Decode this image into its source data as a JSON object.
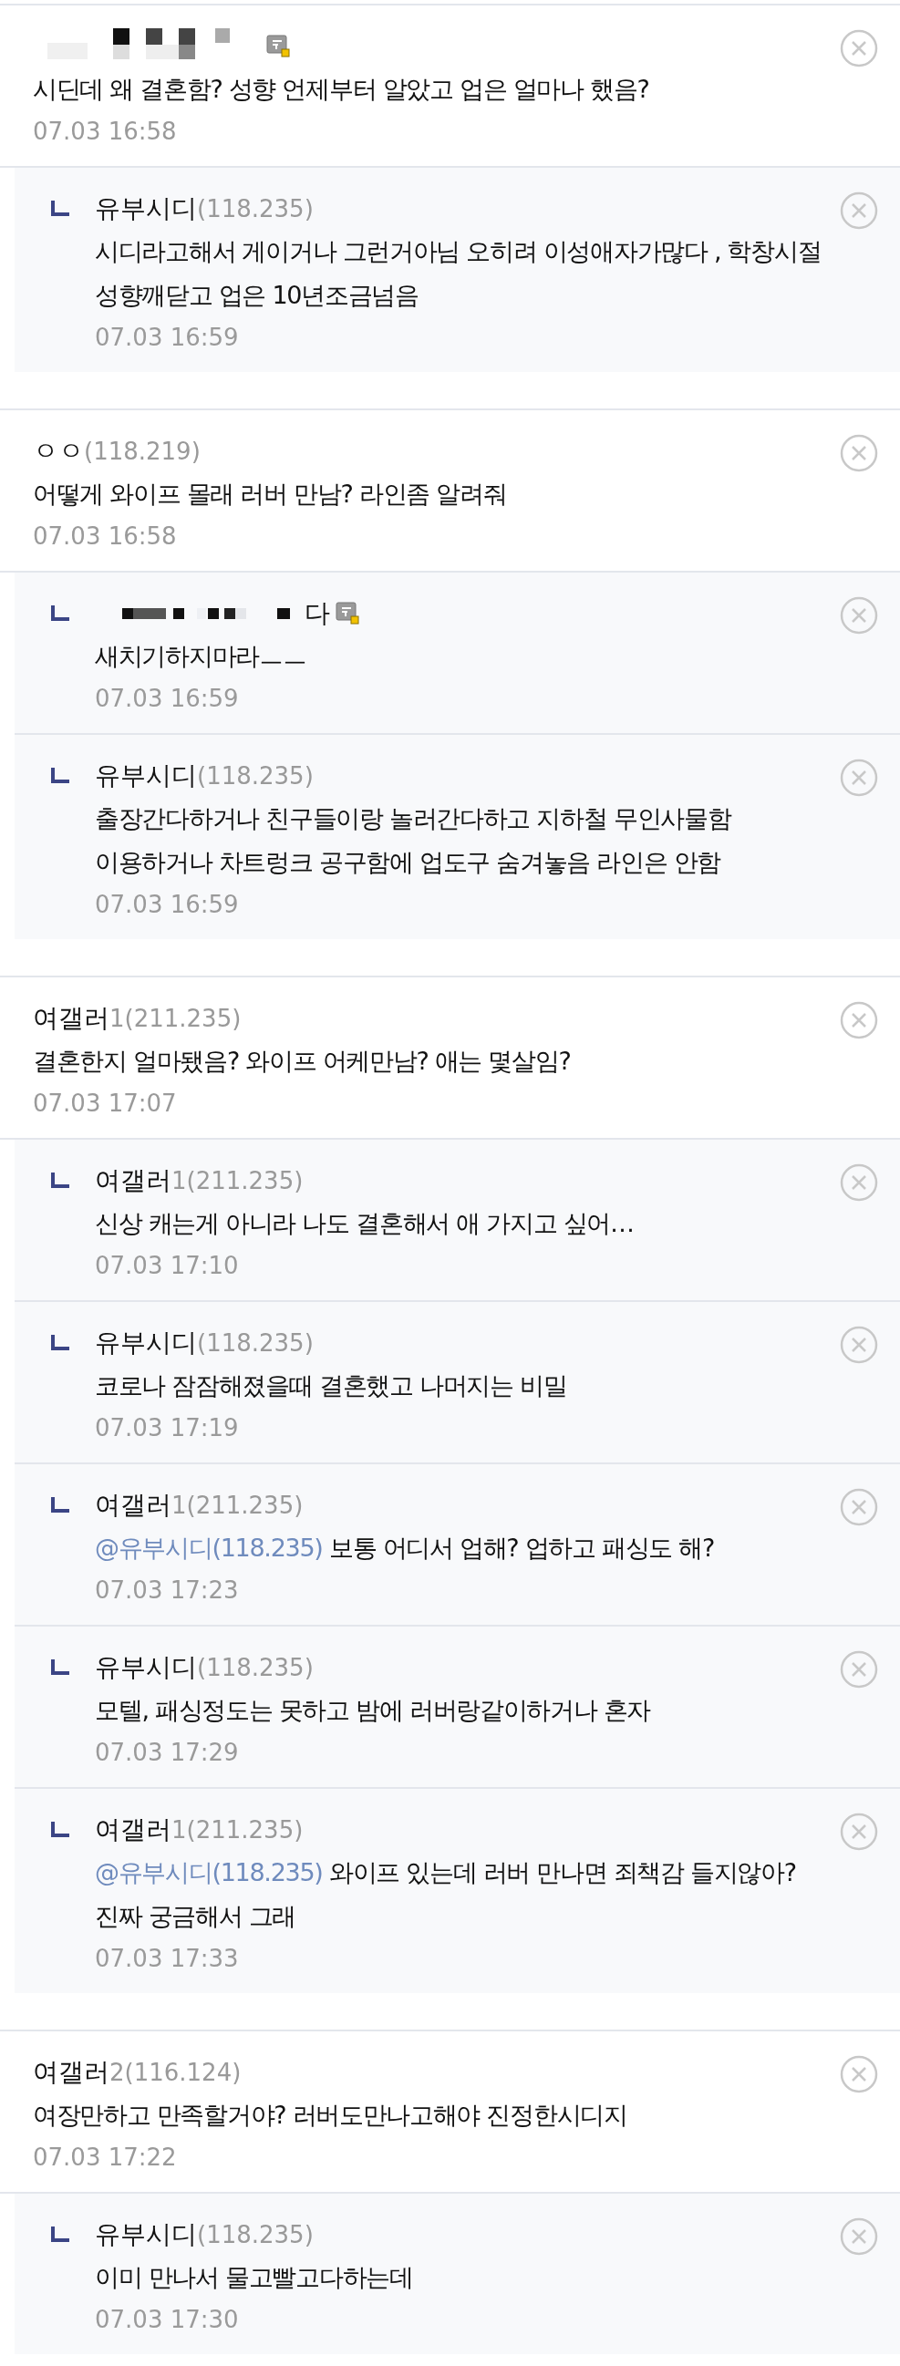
{
  "threads": [
    {
      "comment": {
        "kind": "censored",
        "member_icon": true,
        "text": "시딘데 왜 결혼함? 성향 언제부터 알았고 업은 얼마나 했음?",
        "date": "07.03 16:58"
      },
      "replies": [
        {
          "kind": "text",
          "nick": "유부시디",
          "ip": "(118.235)",
          "text": "시디라고해서 게이거나 그런거아님 오히려 이성애자가많다 , 학창시절 성향깨닫고 업은 10년조금넘음",
          "date": "07.03 16:59"
        }
      ]
    },
    {
      "comment": {
        "kind": "text",
        "nick": "ㅇㅇ",
        "ip": "(118.219)",
        "text": "어떻게 와이프 몰래 러버 만남? 라인좀 알려줘",
        "date": "07.03 16:58"
      },
      "replies": [
        {
          "kind": "censored",
          "nick_tail": "다",
          "member_icon": true,
          "text": "새치기하지마라ㅡㅡ",
          "date": "07.03 16:59"
        },
        {
          "kind": "text",
          "nick": "유부시디",
          "ip": "(118.235)",
          "text": "출장간다하거나 친구들이랑 놀러간다하고 지하철 무인사물함 이용하거나 차트렁크 공구함에 업도구 숨겨놓음 라인은 안함",
          "date": "07.03 16:59"
        }
      ]
    },
    {
      "comment": {
        "kind": "text",
        "nick": "여갤러",
        "ip": "1(211.235)",
        "text": "결혼한지 얼마됐음? 와이프 어케만남? 애는 몇살임?",
        "date": "07.03 17:07"
      },
      "replies": [
        {
          "kind": "text",
          "nick": "여갤러",
          "ip": "1(211.235)",
          "text": "신상 캐는게 아니라 나도 결혼해서 애 가지고 싶어…",
          "date": "07.03 17:10"
        },
        {
          "kind": "text",
          "nick": "유부시디",
          "ip": "(118.235)",
          "text": "코로나 잠잠해졌을때 결혼했고 나머지는 비밀",
          "date": "07.03 17:19"
        },
        {
          "kind": "text",
          "nick": "여갤러",
          "ip": "1(211.235)",
          "mention": "@유부시디(118.235)",
          "text": "보통 어디서 업해? 업하고 패싱도 해?",
          "date": "07.03 17:23"
        },
        {
          "kind": "text",
          "nick": "유부시디",
          "ip": "(118.235)",
          "text": "모텔, 패싱정도는 못하고 밤에 러버랑같이하거나 혼자",
          "date": "07.03 17:29"
        },
        {
          "kind": "text",
          "nick": "여갤러",
          "ip": "1(211.235)",
          "mention": "@유부시디(118.235)",
          "text": "와이프 있는데 러버 만나면 죄책감 들지않아? 진짜 궁금해서 그래",
          "date": "07.03 17:33"
        }
      ]
    },
    {
      "comment": {
        "kind": "text",
        "nick": "여갤러",
        "ip": "2(116.124)",
        "text": "여장만하고 만족할거야? 러버도만나고해야 진정한시디지",
        "date": "07.03 17:22"
      },
      "replies": [
        {
          "kind": "text",
          "nick": "유부시디",
          "ip": "(118.235)",
          "text": "이미 만나서 물고빨고다하는데",
          "date": "07.03 17:30"
        }
      ]
    }
  ]
}
